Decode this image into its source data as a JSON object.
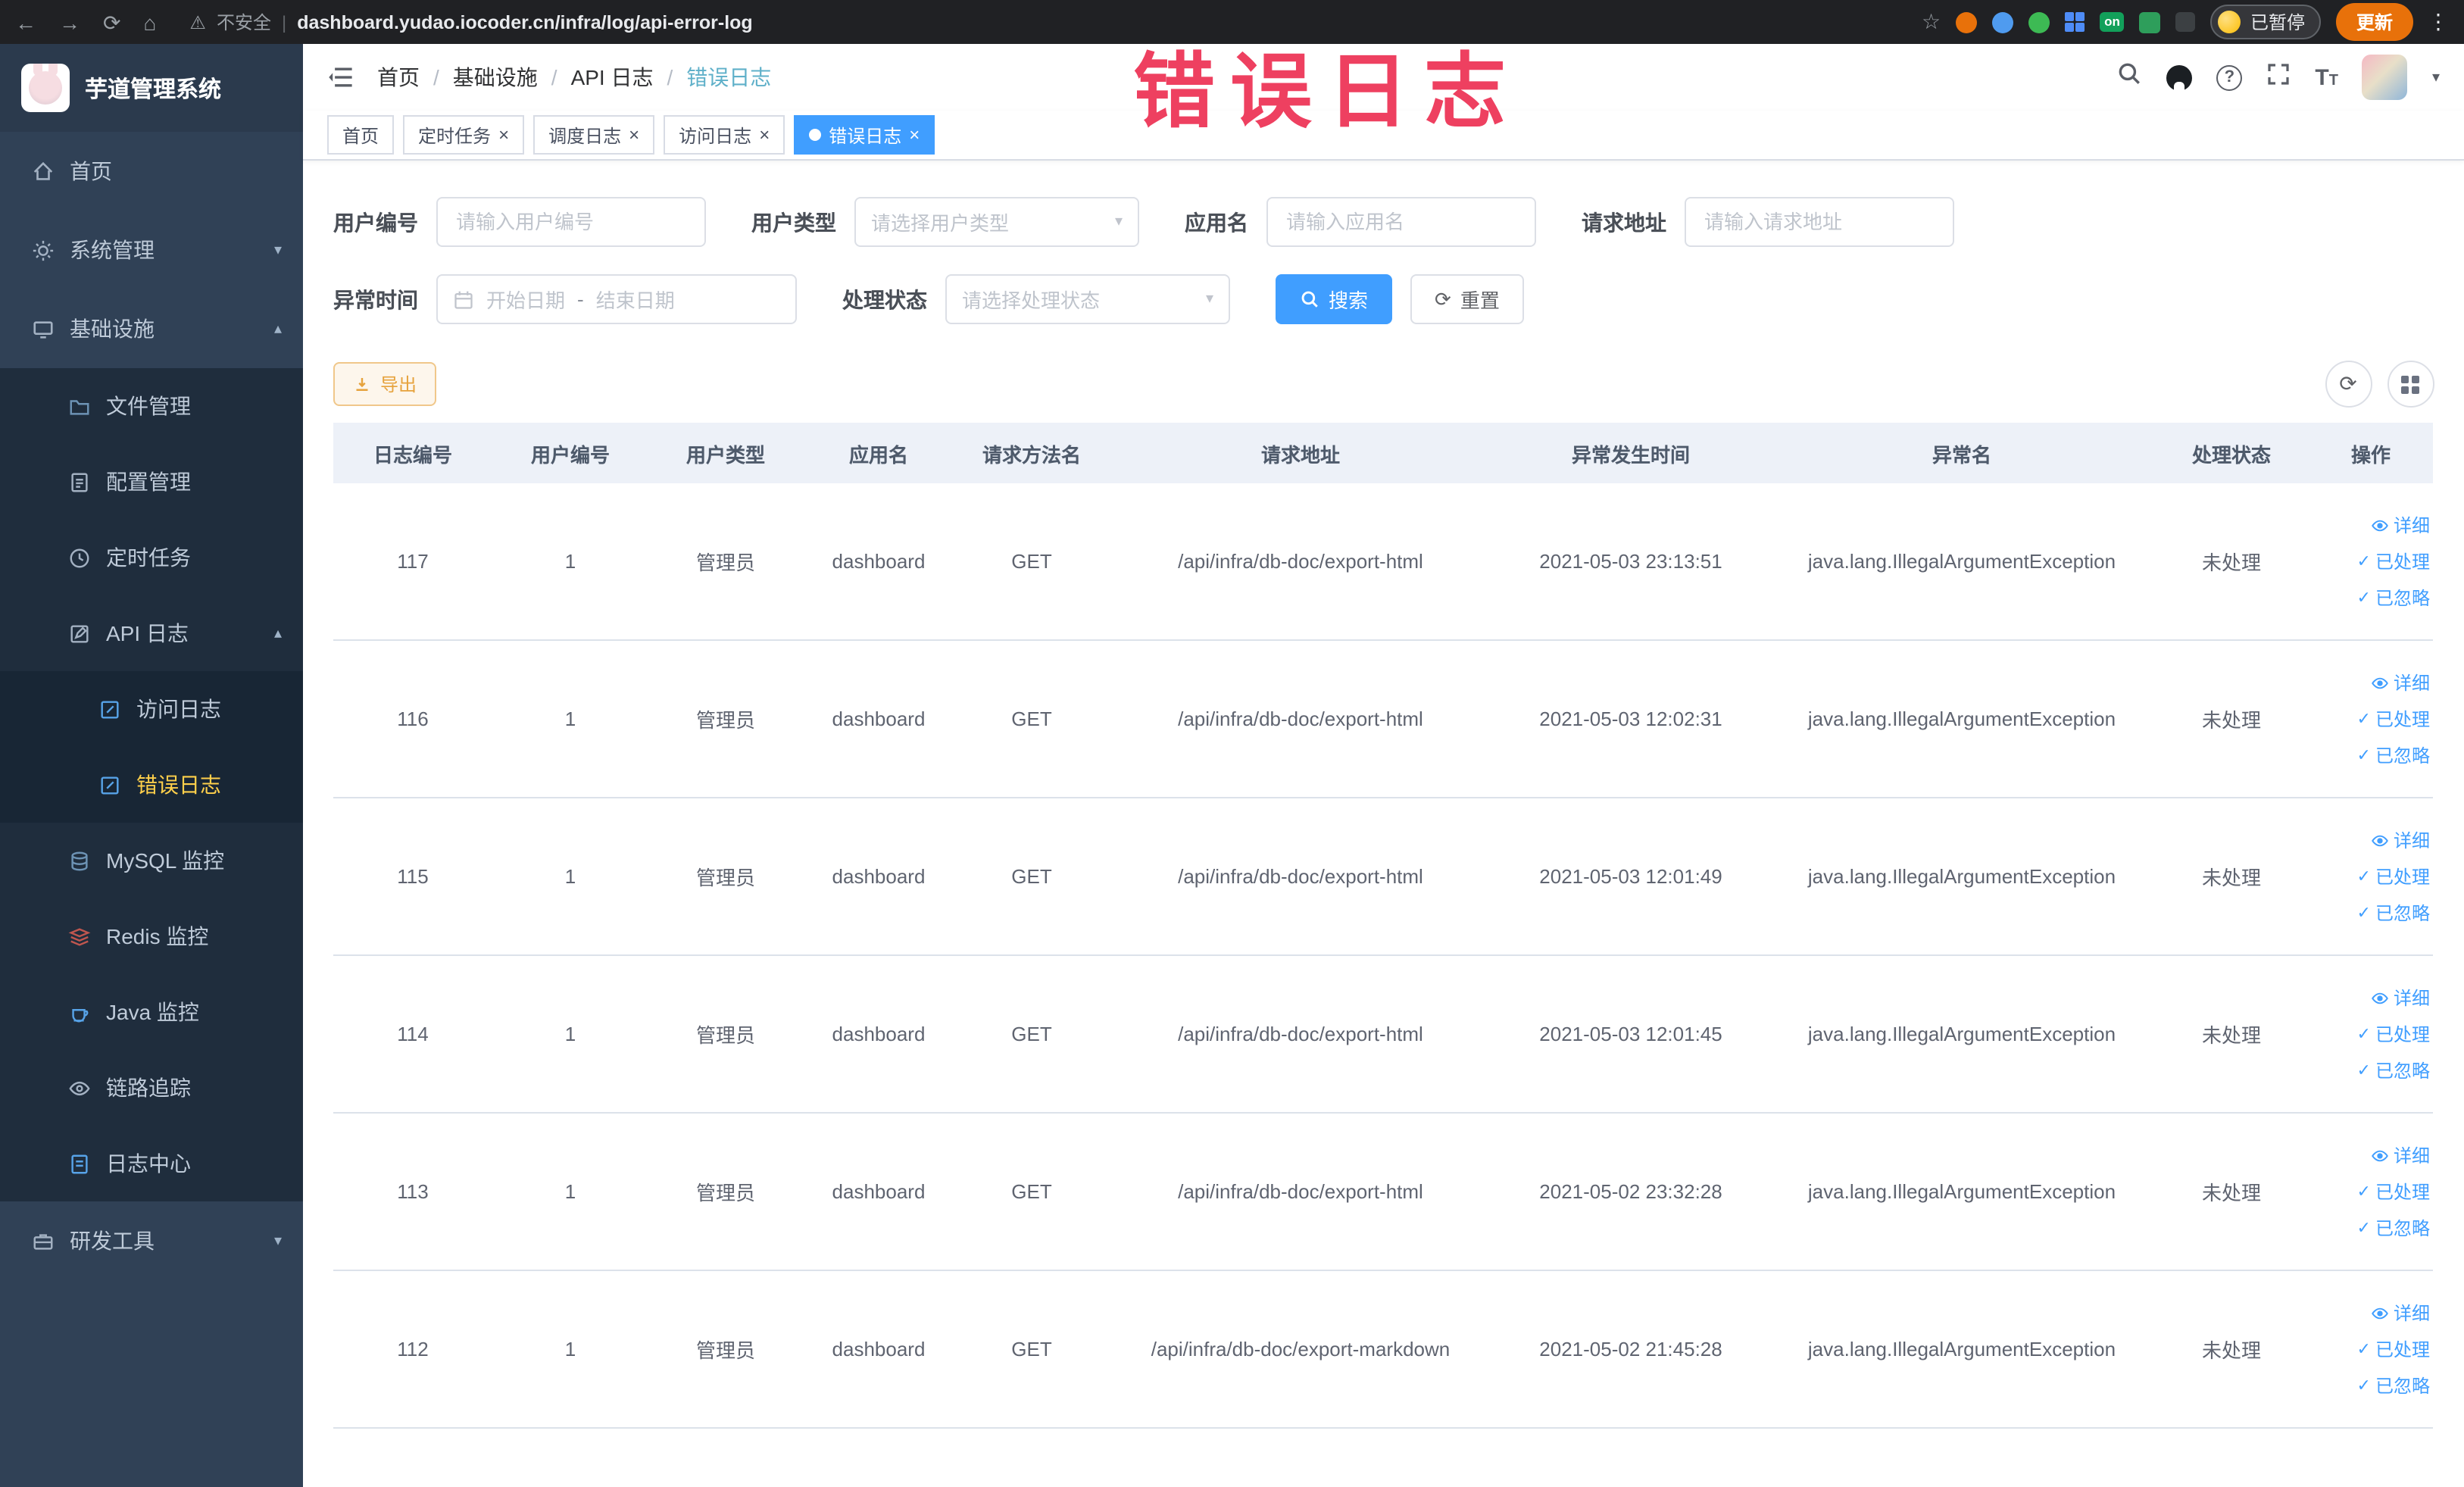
{
  "browser": {
    "security_label": "不安全",
    "url": "dashboard.yudao.iocoder.cn/infra/log/api-error-log",
    "extension_on_badge": "on",
    "paused_badge": "已暂停",
    "update_button": "更新"
  },
  "annotation": {
    "text": "错误日志"
  },
  "sidebar": {
    "logo_title": "芋道管理系统",
    "menu": {
      "home": "首页",
      "system": "系统管理",
      "infra": "基础设施",
      "dev_tools": "研发工具"
    },
    "infra_children": {
      "file": "文件管理",
      "config": "配置管理",
      "job": "定时任务",
      "api_log": "API 日志",
      "mysql": "MySQL 监控",
      "redis": "Redis 监控",
      "java": "Java 监控",
      "trace": "链路追踪",
      "log_center": "日志中心"
    },
    "api_log_children": {
      "access": "访问日志",
      "error": "错误日志"
    }
  },
  "breadcrumb": {
    "items": [
      "首页",
      "基础设施",
      "API 日志",
      "错误日志"
    ]
  },
  "tabs": [
    {
      "label": "首页"
    },
    {
      "label": "定时任务"
    },
    {
      "label": "调度日志"
    },
    {
      "label": "访问日志"
    },
    {
      "label": "错误日志"
    }
  ],
  "filters": {
    "user_id": {
      "label": "用户编号",
      "placeholder": "请输入用户编号"
    },
    "user_type": {
      "label": "用户类型",
      "placeholder": "请选择用户类型"
    },
    "app_name": {
      "label": "应用名",
      "placeholder": "请输入应用名"
    },
    "request_url": {
      "label": "请求地址",
      "placeholder": "请输入请求地址"
    },
    "exception_time": {
      "label": "异常时间",
      "start_placeholder": "开始日期",
      "separator": "-",
      "end_placeholder": "结束日期"
    },
    "process_status": {
      "label": "处理状态",
      "placeholder": "请选择处理状态"
    },
    "search_button": "搜索",
    "reset_button": "重置"
  },
  "toolbar": {
    "export_button": "导出"
  },
  "table": {
    "columns": [
      "日志编号",
      "用户编号",
      "用户类型",
      "应用名",
      "请求方法名",
      "请求地址",
      "异常发生时间",
      "异常名",
      "处理状态",
      "操作"
    ],
    "action_labels": {
      "detail": "详细",
      "processed": "已处理",
      "ignored": "已忽略"
    },
    "rows": [
      {
        "log_id": "117",
        "user_id": "1",
        "user_type": "管理员",
        "app_name": "dashboard",
        "method": "GET",
        "url": "/api/infra/db-doc/export-html",
        "time": "2021-05-03 23:13:51",
        "exception": "java.lang.IllegalArgumentException",
        "status": "未处理"
      },
      {
        "log_id": "116",
        "user_id": "1",
        "user_type": "管理员",
        "app_name": "dashboard",
        "method": "GET",
        "url": "/api/infra/db-doc/export-html",
        "time": "2021-05-03 12:02:31",
        "exception": "java.lang.IllegalArgumentException",
        "status": "未处理"
      },
      {
        "log_id": "115",
        "user_id": "1",
        "user_type": "管理员",
        "app_name": "dashboard",
        "method": "GET",
        "url": "/api/infra/db-doc/export-html",
        "time": "2021-05-03 12:01:49",
        "exception": "java.lang.IllegalArgumentException",
        "status": "未处理"
      },
      {
        "log_id": "114",
        "user_id": "1",
        "user_type": "管理员",
        "app_name": "dashboard",
        "method": "GET",
        "url": "/api/infra/db-doc/export-html",
        "time": "2021-05-03 12:01:45",
        "exception": "java.lang.IllegalArgumentException",
        "status": "未处理"
      },
      {
        "log_id": "113",
        "user_id": "1",
        "user_type": "管理员",
        "app_name": "dashboard",
        "method": "GET",
        "url": "/api/infra/db-doc/export-html",
        "time": "2021-05-02 23:32:28",
        "exception": "java.lang.IllegalArgumentException",
        "status": "未处理"
      },
      {
        "log_id": "112",
        "user_id": "1",
        "user_type": "管理员",
        "app_name": "dashboard",
        "method": "GET",
        "url": "/api/infra/db-doc/export-markdown",
        "time": "2021-05-02 21:45:28",
        "exception": "java.lang.IllegalArgumentException",
        "status": "未处理"
      }
    ]
  }
}
